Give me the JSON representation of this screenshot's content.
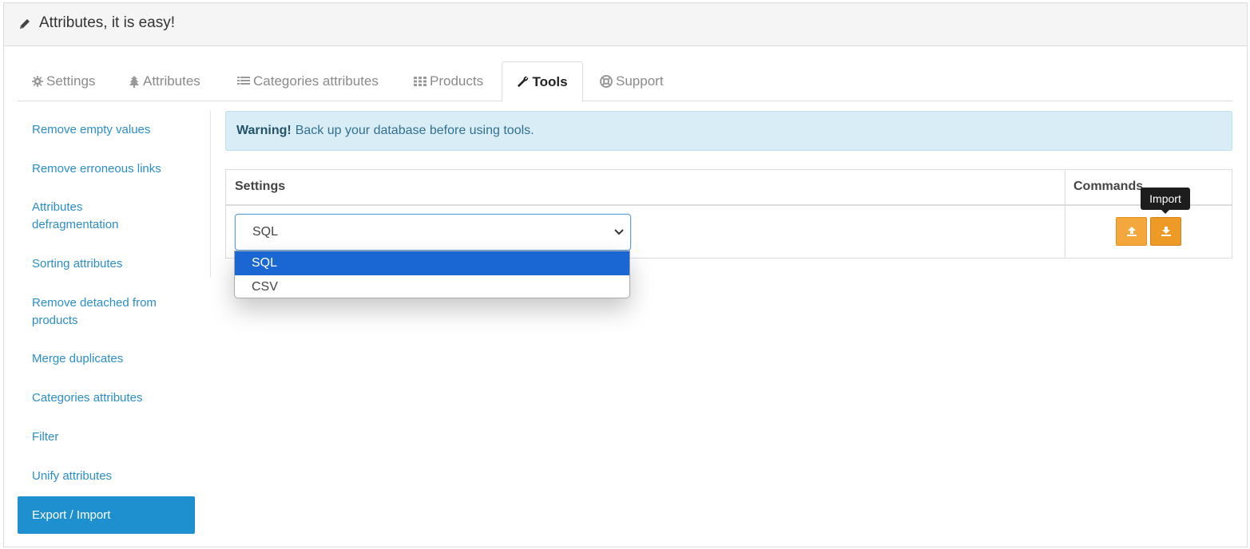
{
  "header": {
    "title": "Attributes, it is easy!",
    "icon": "pencil-icon"
  },
  "tabs": [
    {
      "label": "Settings",
      "icon": "gear-icon"
    },
    {
      "label": "Attributes",
      "icon": "tree-icon"
    },
    {
      "label": "Categories attributes",
      "icon": "list-icon"
    },
    {
      "label": "Products",
      "icon": "grid-icon"
    },
    {
      "label": "Tools",
      "icon": "wrench-icon",
      "active": true
    },
    {
      "label": "Support",
      "icon": "lifebuoy-icon"
    }
  ],
  "sidebar": {
    "items": [
      {
        "label": "Remove empty values"
      },
      {
        "label": "Remove erroneous links"
      },
      {
        "label": "Attributes defragmentation"
      },
      {
        "label": "Sorting attributes"
      },
      {
        "label": "Remove detached from products"
      },
      {
        "label": "Merge duplicates"
      },
      {
        "label": "Categories attributes"
      },
      {
        "label": "Filter"
      },
      {
        "label": "Unify attributes"
      },
      {
        "label": "Export / Import",
        "active": true
      }
    ]
  },
  "alert": {
    "strong": "Warning!",
    "text": "Back up your database before using tools."
  },
  "table": {
    "headers": {
      "settings": "Settings",
      "commands": "Commands"
    },
    "format_select": {
      "value": "SQL",
      "options": [
        "SQL",
        "CSV"
      ],
      "highlighted": "SQL"
    },
    "buttons": [
      {
        "name": "export",
        "icon": "upload-icon"
      },
      {
        "name": "import",
        "icon": "download-icon",
        "tooltip": "Import"
      }
    ]
  },
  "colors": {
    "accent": "#1e90d0",
    "link": "#2b8ec8",
    "button": "#f3a73c",
    "alert_bg": "#d9edf7",
    "dropdown_highlight": "#1a66d2"
  }
}
